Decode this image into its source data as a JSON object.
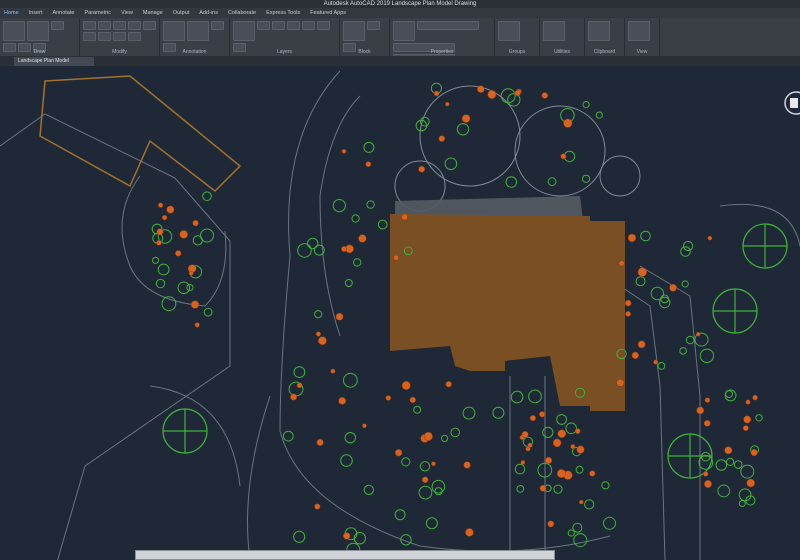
{
  "app": {
    "title": "Autodesk AutoCAD 2019   Landscape Plan Model Drawing"
  },
  "tabs": [
    "Home",
    "Insert",
    "Annotate",
    "Parametric",
    "View",
    "Manage",
    "Output",
    "Add-ins",
    "Collaborate",
    "Express Tools",
    "Featured Apps"
  ],
  "active_tab": "Home",
  "ribbon_panels": [
    "Draw",
    "Modify",
    "Annotation",
    "Layers",
    "Block",
    "Properties",
    "Groups",
    "Utilities",
    "Clipboard",
    "View"
  ],
  "file_tab": "Landscape Plan Model",
  "colors": {
    "background": "#1f2836",
    "building_fill": "#7a4f23",
    "paving": "#555b63",
    "plant_green": "#3fb23b",
    "plant_orange": "#d9621f",
    "boundary": "#a3722b",
    "path_lines": "#8a95a3"
  },
  "icons": [
    "new-icon",
    "open-icon",
    "save-icon",
    "undo-icon",
    "redo-icon",
    "line-icon",
    "polyline-icon",
    "circle-icon",
    "arc-icon",
    "move-icon",
    "copy-icon",
    "stretch-icon",
    "text-icon",
    "dimension-icon",
    "layer-icon",
    "insert-block-icon",
    "match-properties-icon",
    "group-icon",
    "measure-icon",
    "paste-icon",
    "base-icon",
    "viewcube-icon"
  ]
}
